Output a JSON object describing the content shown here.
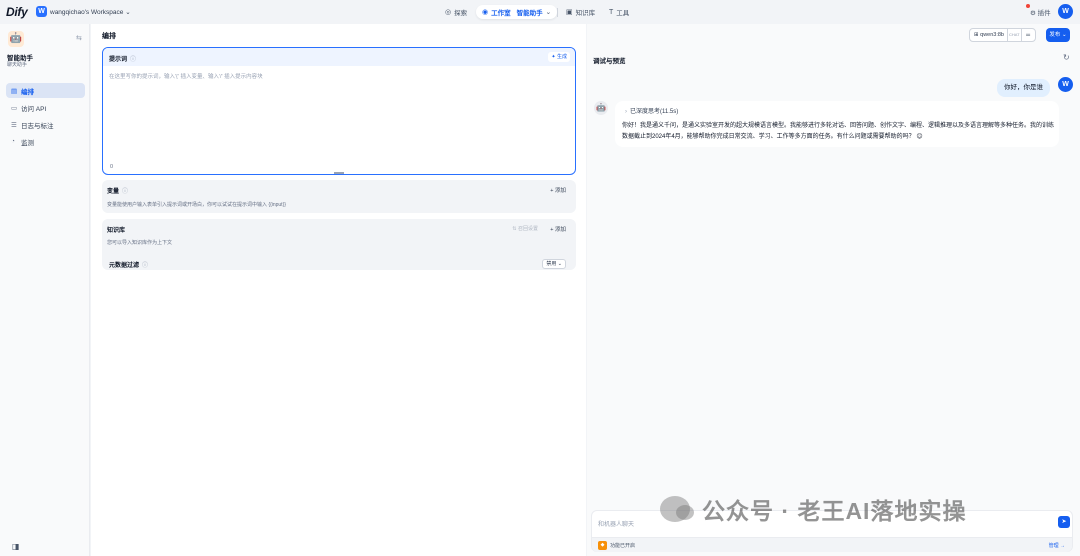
{
  "topbar": {
    "logo": "Dify",
    "workspace_initial": "W",
    "workspace_name": "wangqichao's Workspace",
    "nav_explore": "探索",
    "nav_studio": "工作室",
    "nav_studio_app": "智能助手",
    "nav_knowledge": "知识库",
    "nav_tools": "工具",
    "plugins": "插件",
    "user_initial": "W"
  },
  "sidebar": {
    "app_name": "智能助手",
    "app_type": "聊天助手",
    "items": [
      {
        "label": "编排",
        "icon": "orchestrate-icon",
        "active": true
      },
      {
        "label": "访问 API",
        "icon": "api-icon",
        "active": false
      },
      {
        "label": "日志与标注",
        "icon": "logs-icon",
        "active": false
      },
      {
        "label": "监测",
        "icon": "monitor-icon",
        "active": false
      }
    ]
  },
  "main": {
    "title": "编排",
    "prompt": {
      "label": "提示词",
      "generate": "生成",
      "placeholder": "在这里写你的提示词，输入'{' 插入变量、输入'/' 插入提示内容块",
      "char_count": "0"
    },
    "variables": {
      "label": "变量",
      "add": "添加",
      "desc": "变量能使用户输入表单引入提示词或开场白，你可以试试在提示词中输入 {{input}}"
    },
    "knowledge": {
      "label": "知识库",
      "recall": "召回设置",
      "add": "添加",
      "desc": "您可以导入知识库作为上下文",
      "filter_label": "元数据过滤",
      "filter_value": "禁用"
    }
  },
  "debug": {
    "title": "调试与预览",
    "model": "qwen3:8b",
    "model_tag": "CHAT",
    "publish": "发布",
    "user_message": "你好，你是谁",
    "thought": "已深度思考(11.5s)",
    "reply": "你好！我是通义千问，是通义实验室开发的超大规模语言模型。我能够进行多轮对话、回答问题、创作文字、编程、逻辑推理以及多语言理解等多种任务。我的训练数据截止到2024年4月，能够帮助你完成日常交流、学习、工作等多方面的任务。有什么问题或需要帮助的吗？ 😊",
    "input_placeholder": "和机器人聊天",
    "feature_text": "功能已开启",
    "manage": "管理"
  },
  "watermark": "公众号 · 老王AI落地实操",
  "colors": {
    "accent": "#155eef",
    "prompt_border": "#2970ff",
    "background": "#f2f4f7"
  }
}
